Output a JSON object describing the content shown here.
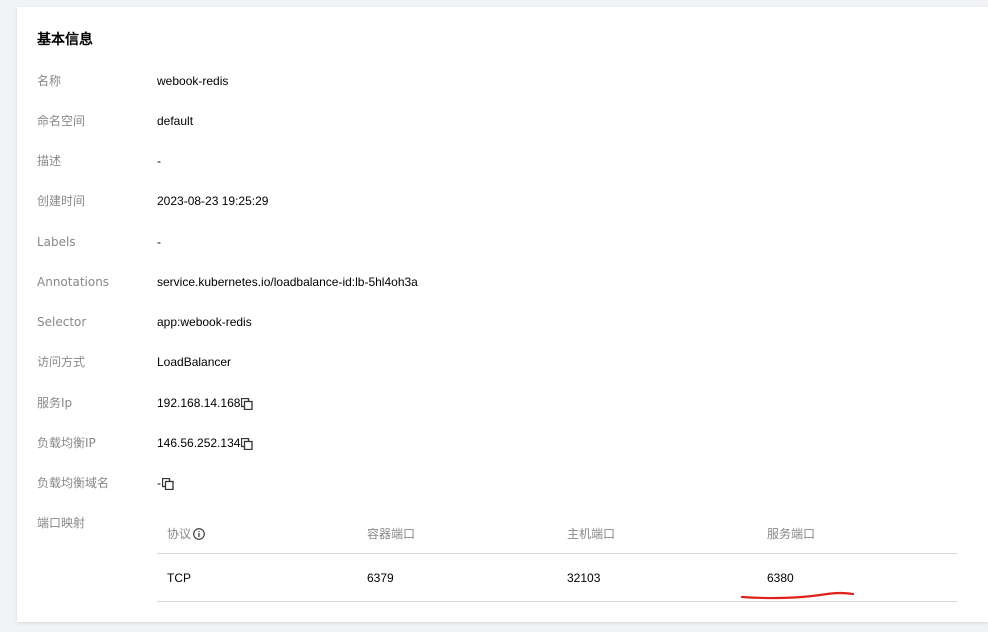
{
  "section": {
    "title": "基本信息"
  },
  "fields": [
    {
      "label": "名称",
      "value": "webook-redis"
    },
    {
      "label": "命名空间",
      "value": "default"
    },
    {
      "label": "描述",
      "value": "-"
    },
    {
      "label": "创建时间",
      "value": "2023-08-23 19:25:29"
    },
    {
      "label": "Labels",
      "value": "-"
    },
    {
      "label": "Annotations",
      "value": "service.kubernetes.io/loadbalance-id:lb-5hl4oh3a"
    },
    {
      "label": "Selector",
      "value": "app:webook-redis"
    },
    {
      "label": "访问方式",
      "value": "LoadBalancer"
    },
    {
      "label": "服务Ip",
      "value": "192.168.14.168"
    },
    {
      "label": "负载均衡IP",
      "value": "146.56.252.134"
    },
    {
      "label": "负载均衡域名",
      "value": "-"
    }
  ],
  "ports": {
    "label": "端口映射",
    "headers": [
      "协议",
      "容器端口",
      "主机端口",
      "服务端口"
    ],
    "rows": [
      [
        "TCP",
        "6379",
        "32103",
        "6380"
      ]
    ]
  },
  "icons": {
    "copy": "copy-icon",
    "info": "info-circle-icon"
  },
  "colors": {
    "annotation": "#e0201b",
    "label": "#888888"
  }
}
